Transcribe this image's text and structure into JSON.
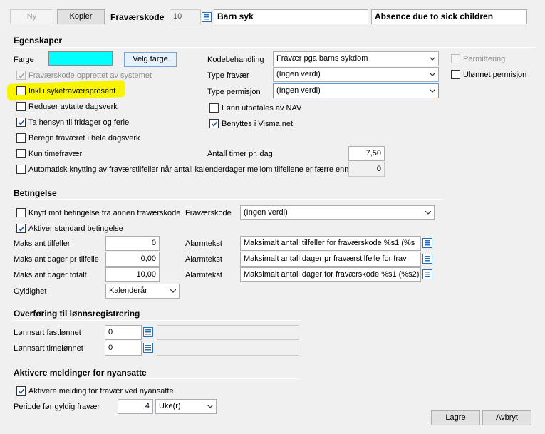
{
  "toolbar": {
    "new_label": "Ny",
    "copy_label": "Kopier",
    "code_label": "Fraværskode",
    "code_value": "10",
    "name_value": "Barn syk",
    "english_name_value": "Absence due to sick children"
  },
  "properties": {
    "section_title": "Egenskaper",
    "color_label": "Farge",
    "color_value": "#00ffff",
    "choose_color_label": "Velg farge",
    "created_by_system_label": "Fraværskode opprettet av systemet",
    "incl_sick_pct_label": "Inkl i sykefraværsprosent",
    "reduce_workday_label": "Reduser avtalte dagsverk",
    "consider_holidays_label": "Ta hensyn til fridager og ferie",
    "full_workday_label": "Beregn fraværet i hele dagsverk",
    "hour_only_label": "Kun timefravær",
    "auto_link_label": "Automatisk knytting av fraværstilfeller når antall kalenderdager mellom tilfellene er færre enn",
    "auto_link_value": "0",
    "code_handling_label": "Kodebehandling",
    "code_handling_value": "Fravær pga barns sykdom",
    "absence_type_label": "Type fravær",
    "absence_type_value": "(Ingen verdi)",
    "leave_type_label": "Type permisjon",
    "leave_type_value": "(Ingen verdi)",
    "nav_pay_label": "Lønn utbetales av NAV",
    "visma_label": "Benyttes i Visma.net",
    "hours_per_day_label": "Antall timer pr. dag",
    "hours_per_day_value": "7,50",
    "layoff_label": "Permittering",
    "unpaid_leave_label": "Ulønnet permisjon"
  },
  "condition": {
    "section_title": "Betingelse",
    "link_other_label": "Knytt mot betingelse fra annen fraværskode",
    "absence_code_label": "Fraværskode",
    "absence_code_value": "(Ingen verdi)",
    "activate_standard_label": "Aktiver standard betingelse",
    "rows": [
      {
        "label": "Maks ant tilfeller",
        "value": "0",
        "alarm_label": "Alarmtekst",
        "alarm_value": "Maksimalt antall tilfeller for fraværskode %s1 (%s"
      },
      {
        "label": "Maks ant dager pr tilfelle",
        "value": "0,00",
        "alarm_label": "Alarmtekst",
        "alarm_value": "Maksimalt antall dager pr fraværstilfelle for frav"
      },
      {
        "label": "Maks ant dager totalt",
        "value": "10,00",
        "alarm_label": "Alarmtekst",
        "alarm_value": "Maksimalt antall dager for fraværskode %s1 (%s2)"
      }
    ],
    "validity_label": "Gyldighet",
    "validity_value": "Kalenderår"
  },
  "transfer": {
    "section_title": "Overføring til lønnsregistrering",
    "fixed_label": "Lønnsart fastlønnet",
    "fixed_value": "0",
    "hourly_label": "Lønnsart timelønnet",
    "hourly_value": "0"
  },
  "notify": {
    "section_title": "Aktivere meldinger for nyansatte",
    "activate_label": "Aktivere melding for fravær ved nyansatte",
    "period_label": "Periode før gyldig fravær",
    "period_value": "4",
    "period_unit": "Uke(r)"
  },
  "footer": {
    "save_label": "Lagre",
    "cancel_label": "Avbryt"
  },
  "colors": {
    "highlight": "#f9f400",
    "accent_border": "#569de5"
  }
}
